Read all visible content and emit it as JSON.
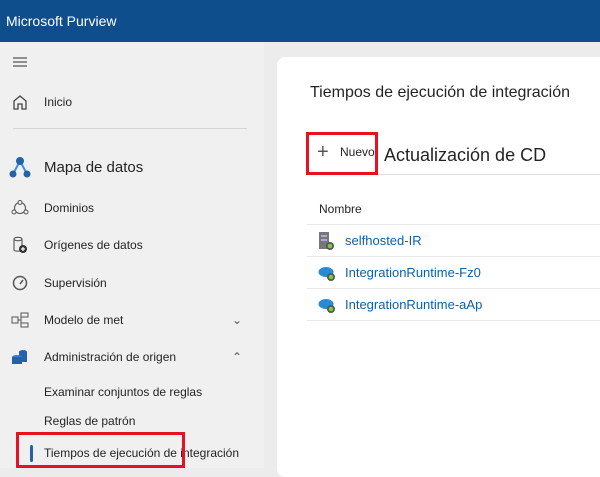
{
  "header": {
    "title": "Microsoft Purview"
  },
  "sidebar": {
    "home": "Inicio",
    "section": "Mapa de datos",
    "items": [
      {
        "label": "Dominios"
      },
      {
        "label": "Orígenes de datos"
      },
      {
        "label": "Supervisión"
      },
      {
        "label": "Modelo de met"
      },
      {
        "label": "Administración de origen"
      }
    ],
    "subitems": [
      {
        "label": "Examinar conjuntos de reglas"
      },
      {
        "label": "Reglas de patrón"
      },
      {
        "label": "Tiempos de ejecución de integración"
      }
    ]
  },
  "main": {
    "title": "Tiempos de ejecución de integración",
    "toolbar": {
      "new_label": "Nuevo",
      "refresh_label": "Actualización de CD"
    },
    "table": {
      "header": "Nombre",
      "rows": [
        {
          "name": "selfhosted-IR",
          "type": "self-hosted"
        },
        {
          "name": "IntegrationRuntime-Fz0",
          "type": "azure"
        },
        {
          "name": "IntegrationRuntime-aAp",
          "type": "azure"
        }
      ]
    }
  }
}
